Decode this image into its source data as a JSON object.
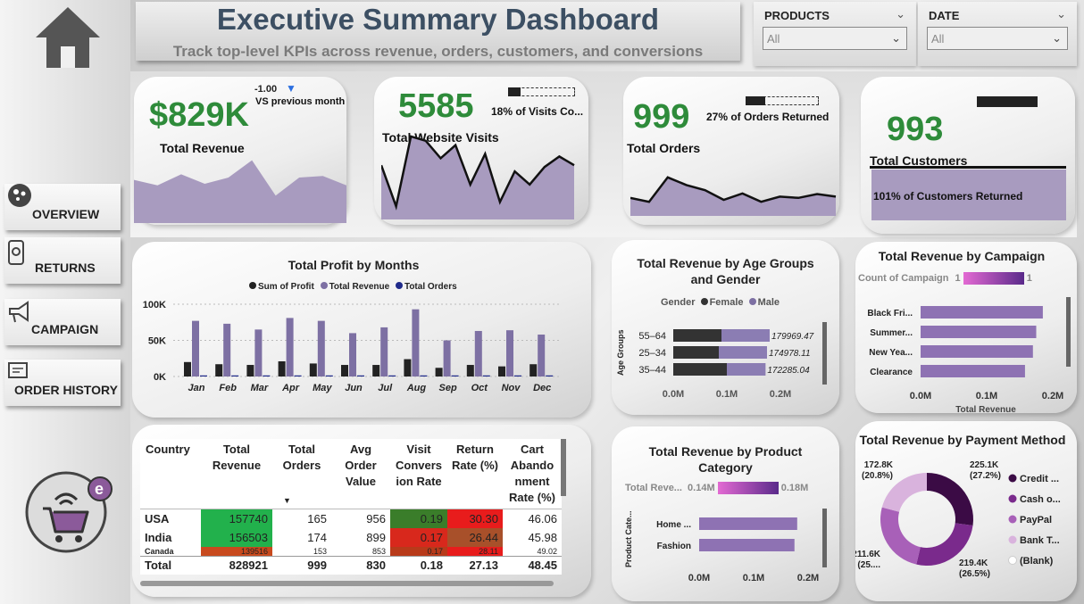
{
  "header": {
    "title": "Executive Summary Dashboard",
    "subtitle": "Track top-level KPIs across revenue, orders, customers, and conversions"
  },
  "slicers": {
    "products": {
      "label": "PRODUCTS",
      "value": "All"
    },
    "date": {
      "label": "DATE",
      "value": "All"
    }
  },
  "nav": {
    "overview": "OVERVIEW",
    "returns": "RETURNS",
    "campaign": "CAMPAIGN",
    "order_history": "ORDER HISTORY"
  },
  "kpis": {
    "revenue": {
      "value": "$829K",
      "label": "Total Revenue",
      "delta": "-1.00",
      "delta_label": "VS previous month",
      "trend": [
        55,
        48,
        62,
        50,
        58,
        80,
        35,
        58,
        60,
        48
      ]
    },
    "visits": {
      "value": "5585",
      "label": "Total Website Visits",
      "sub": "18% of Visits Co...",
      "progress": 0.18,
      "trend": [
        62,
        15,
        95,
        90,
        70,
        85,
        40,
        75,
        20,
        55,
        40,
        60,
        72,
        62
      ]
    },
    "orders": {
      "value": "999",
      "label": "Total Orders",
      "sub": "27% of Orders Returned",
      "progress": 0.27,
      "trend": [
        28,
        22,
        60,
        48,
        40,
        25,
        35,
        22,
        30,
        28,
        34,
        30
      ]
    },
    "customers": {
      "value": "993",
      "label": "Total Customers",
      "sub": "101% of Customers Returned",
      "progress": 1.0
    }
  },
  "profit_chart": {
    "title": "Total Profit by Months",
    "legend": [
      "Sum of Profit",
      "Total Revenue",
      "Total Orders"
    ],
    "colors": {
      "profit": "#222222",
      "revenue": "#7d70a3",
      "orders": "#1f2a8a"
    },
    "y_ticks": [
      "100K",
      "50K",
      "0K"
    ]
  },
  "chart_data": [
    {
      "type": "bar",
      "title": "Total Profit by Months",
      "categories": [
        "Jan",
        "Feb",
        "Mar",
        "Apr",
        "May",
        "Jun",
        "Jul",
        "Aug",
        "Sep",
        "Oct",
        "Nov",
        "Dec"
      ],
      "series": [
        {
          "name": "Sum of Profit",
          "values": [
            20000,
            17000,
            16000,
            21000,
            18000,
            16000,
            16000,
            24000,
            12000,
            16000,
            14000,
            17000
          ]
        },
        {
          "name": "Total Revenue",
          "values": [
            77000,
            73000,
            65000,
            81000,
            77000,
            60000,
            68000,
            93000,
            50000,
            63000,
            64000,
            58000
          ]
        },
        {
          "name": "Total Orders",
          "values": [
            90,
            85,
            80,
            95,
            90,
            70,
            80,
            110,
            60,
            75,
            78,
            68
          ]
        }
      ],
      "ylim": [
        0,
        100000
      ]
    },
    {
      "type": "bar",
      "title": "Total Revenue by Age Groups and Gender",
      "categories": [
        "55–64",
        "25–34",
        "35–44"
      ],
      "series": [
        {
          "name": "Female",
          "values": [
            90000,
            85000,
            100000
          ]
        },
        {
          "name": "Male",
          "values": [
            89969.47,
            89978.11,
            72285.04
          ]
        }
      ],
      "totals": [
        "179969.47",
        "174978.11",
        "172285.04"
      ],
      "xlim": [
        0,
        200000
      ]
    },
    {
      "type": "bar",
      "title": "Total Revenue by Campaign",
      "categories": [
        "Black Fri...",
        "Summer...",
        "New Yea...",
        "Clearance"
      ],
      "values": [
        185000,
        175000,
        170000,
        158000
      ],
      "xlim": [
        0,
        200000
      ]
    },
    {
      "type": "bar",
      "title": "Total Revenue by Product Category",
      "categories": [
        "Home ...",
        "Fashion"
      ],
      "values": [
        180000,
        175000
      ],
      "xlim": [
        0,
        200000
      ]
    },
    {
      "type": "pie",
      "title": "Total Revenue by Payment Method",
      "categories": [
        "Credit ...",
        "Cash o...",
        "PayPal",
        "Bank T...",
        "(Blank)"
      ],
      "values": [
        225100,
        219400,
        211600,
        172800,
        0
      ],
      "percent": [
        "27.2%",
        "26.5%",
        "25...",
        "20.8%",
        ""
      ]
    }
  ],
  "age_chart": {
    "title_line1": "Total Revenue by Age Groups",
    "title_line2": "and Gender",
    "legend_title": "Gender",
    "legend": [
      "Female",
      "Male"
    ],
    "y_label": "Age Groups",
    "x_ticks": [
      "0.0M",
      "0.1M",
      "0.2M"
    ]
  },
  "campaign_chart": {
    "title": "Total Revenue by Campaign",
    "legend_label": "Count of Campaign",
    "legend_min": "1",
    "legend_max": "1",
    "x_label": "Total Revenue",
    "x_ticks": [
      "0.0M",
      "0.1M",
      "0.2M"
    ]
  },
  "category_chart": {
    "title_line1": "Total Revenue by Product",
    "title_line2": "Category",
    "legend_label": "Total Reve...",
    "legend_min": "0.14M",
    "legend_max": "0.18M",
    "y_label": "Product Cate...",
    "x_ticks": [
      "0.0M",
      "0.1M",
      "0.2M"
    ]
  },
  "payment_chart": {
    "title": "Total Revenue by Payment Method",
    "labels": [
      {
        "v": "225.1K",
        "p": "(27.2%)"
      },
      {
        "v": "219.4K",
        "p": "(26.5%)"
      },
      {
        "v": "211.6K",
        "p": "(25...."
      },
      {
        "v": "172.8K",
        "p": "(20.8%)"
      }
    ],
    "colors": [
      "#3b0b45",
      "#7a2a8c",
      "#a860b8",
      "#d9b3dd",
      "#ffffff"
    ]
  },
  "table": {
    "headers": [
      "Country",
      "Total Revenue",
      "Total Orders",
      "Avg Order Value",
      "Visit Convers ion Rate",
      "Return Rate (%)",
      "Cart Abando nment Rate (%)"
    ],
    "rows": [
      [
        "USA",
        "157740",
        "165",
        "956",
        "0.19",
        "30.30",
        "46.06"
      ],
      [
        "India",
        "156503",
        "174",
        "899",
        "0.17",
        "26.44",
        "45.98"
      ],
      [
        "Canada",
        "139516",
        "153",
        "853",
        "0.17",
        "28.11",
        "49.02"
      ]
    ],
    "total": [
      "Total",
      "828921",
      "999",
      "830",
      "0.18",
      "27.13",
      "48.45"
    ],
    "cell_colors": [
      [
        "",
        "#22b14c",
        "",
        "",
        "#3a7d2a",
        "#e81c1c",
        ""
      ],
      [
        "",
        "#22b14c",
        "",
        "",
        "#d8281c",
        "#a8502a",
        ""
      ],
      [
        "",
        "#c84a1e",
        "",
        "",
        "#b83a1a",
        "#e81c1c",
        ""
      ]
    ]
  }
}
